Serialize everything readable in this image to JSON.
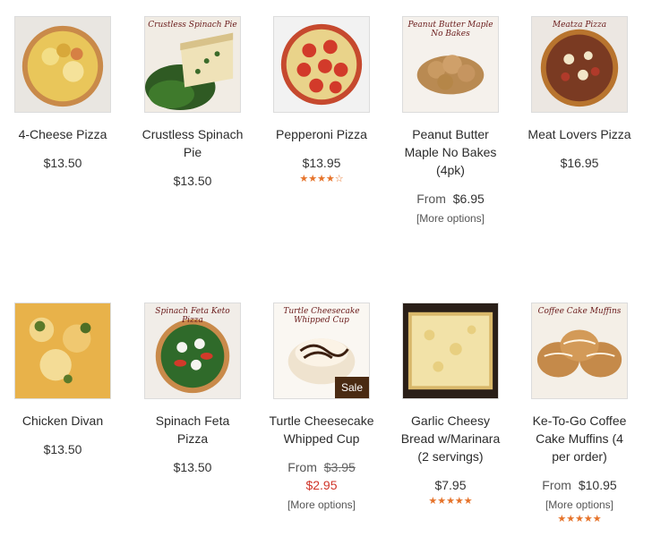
{
  "products": [
    {
      "name": "4-Cheese Pizza",
      "price": "$13.50"
    },
    {
      "name": "Crustless Spinach Pie",
      "price": "$13.50",
      "image_text": "Crustless Spinach Pie"
    },
    {
      "name": "Pepperoni Pizza",
      "price": "$13.95",
      "rating": 4,
      "rating_stars": "★★★★☆"
    },
    {
      "name": "Peanut Butter Maple No Bakes (4pk)",
      "from_label": "From",
      "price": "$6.95",
      "more_options": "[More options]",
      "image_text": "Peanut Butter Maple No Bakes"
    },
    {
      "name": "Meat Lovers Pizza",
      "price": "$16.95",
      "image_text": "Meatza Pizza"
    },
    {
      "name": "Chicken Divan",
      "price": "$13.50"
    },
    {
      "name": "Spinach Feta Pizza",
      "price": "$13.50",
      "image_text": "Spinach Feta Keto Pizza"
    },
    {
      "name": "Turtle Cheesecake Whipped Cup",
      "from_label": "From",
      "old_price": "$3.95",
      "sale_price": "$2.95",
      "more_options": "[More options]",
      "badge": "Sale",
      "image_text": "Turtle Cheesecake Whipped Cup"
    },
    {
      "name": "Garlic Cheesy Bread w/Marinara (2 servings)",
      "price": "$7.95",
      "rating": 5,
      "rating_stars": "★★★★★"
    },
    {
      "name": "Ke-To-Go Coffee Cake Muffins (4 per order)",
      "from_label": "From",
      "price": "$10.95",
      "more_options": "[More options]",
      "rating": 5,
      "rating_stars": "★★★★★",
      "image_text": "Coffee Cake Muffins"
    }
  ],
  "colors": {
    "accent_star": "#e6732a",
    "sale_red": "#d0352a",
    "badge_bg": "#4a2a12"
  }
}
